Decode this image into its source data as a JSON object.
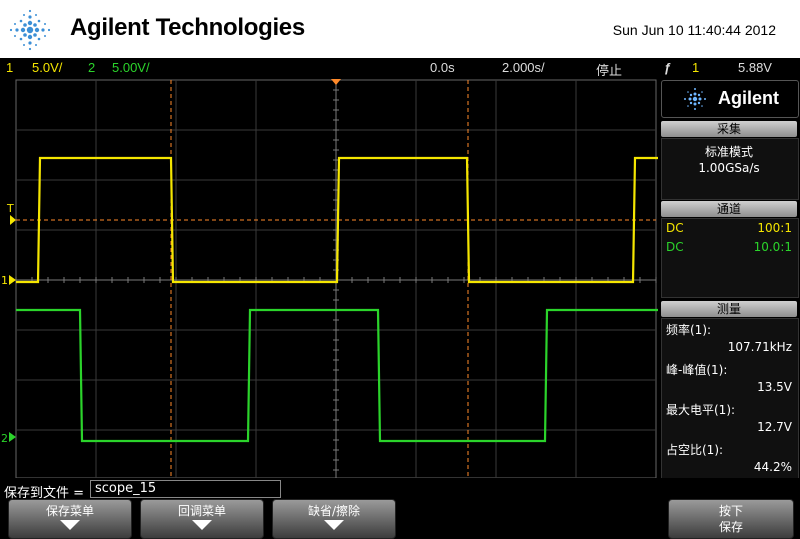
{
  "header": {
    "brand": "Agilent Technologies",
    "datetime": "Sun Jun 10 11:40:44 2012"
  },
  "status": {
    "ch1_num": "1",
    "ch1_scale": "5.0V/",
    "ch2_num": "2",
    "ch2_scale": "5.00V/",
    "time_delay": "0.0s",
    "time_scale": "2.000s/",
    "run_state": "停止",
    "trigger_icon": "rising-edge-icon",
    "trigger_source": "1",
    "trigger_level": "5.88V"
  },
  "screen": {
    "trigger_marker": "T",
    "ch1_marker": "1",
    "ch2_marker": "2",
    "colors": {
      "ch1": "#f5e600",
      "ch2": "#2bd42b",
      "cursor": "#ff8a2a",
      "grid": "#555555"
    }
  },
  "panel": {
    "logo_text": "Agilent",
    "acquire_title": "采集",
    "acquire_mode": "标准模式",
    "acquire_rate": "1.00GSa/s",
    "channel_title": "通道",
    "channels": [
      {
        "coupling": "DC",
        "probe": "100:1"
      },
      {
        "coupling": "DC",
        "probe": "10.0:1"
      }
    ],
    "measure_title": "测量",
    "measurements": [
      {
        "label": "频率(1):",
        "value": "107.71kHz"
      },
      {
        "label": "峰-峰值(1):",
        "value": "13.5V"
      },
      {
        "label": "最大电平(1):",
        "value": "12.7V"
      },
      {
        "label": "占空比(1):",
        "value": "44.2%"
      }
    ]
  },
  "bottom": {
    "save_label": "保存到文件 =",
    "save_value": "scope_15",
    "softkeys": [
      "保存菜单",
      "回调菜单",
      "缺省/擦除"
    ],
    "press_label": "按下",
    "press_action": "保存"
  }
}
